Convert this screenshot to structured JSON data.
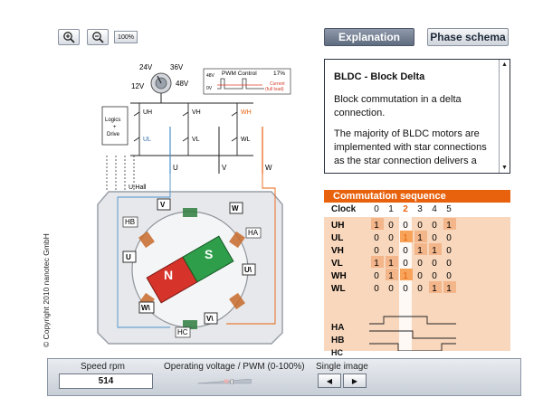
{
  "toolbar": {
    "zoom_in_icon": "zoom-in-icon",
    "zoom_out_icon": "zoom-out-icon",
    "zoom_reset_label": "100%",
    "explanation_label": "Explanation",
    "phase_schema_label": "Phase schema"
  },
  "explanation": {
    "title": "BLDC - Block Delta",
    "paragraph1": "Block commutation in a delta connection.",
    "paragraph2": "The majority of BLDC motors are implemented with star connections as the star connection delivers a"
  },
  "circuit": {
    "voltages": [
      "24V",
      "36V",
      "12V",
      "48V"
    ],
    "pwm_title": "PWM Control",
    "pwm_percent": "17%",
    "pwm_48v": "48V",
    "pwm_0v": "0V",
    "current_label": "Current",
    "current_sub": "(full load)",
    "logic_label_1": "Logics",
    "logic_label_2": "+",
    "logic_label_3": "Drive",
    "switches": [
      "UH",
      "VH",
      "WH",
      "UL",
      "VL",
      "WL"
    ],
    "phases": [
      "U",
      "V",
      "W"
    ],
    "uhall_label": "U-Hall",
    "hall_labels": [
      "HB",
      "HA",
      "HC"
    ],
    "coil_labels": [
      "V",
      "W",
      "U",
      "U\\",
      "W\\",
      "V\\"
    ],
    "rotor_n": "N",
    "rotor_s": "S"
  },
  "commutation": {
    "title": "Commutation sequence",
    "clock_label": "Clock",
    "clock_values": [
      "0",
      "1",
      "2",
      "3",
      "4",
      "5"
    ],
    "active_clock": 2,
    "rows": [
      {
        "label": "UH",
        "values": [
          "1",
          "0",
          "0",
          "0",
          "0",
          "1"
        ]
      },
      {
        "label": "UL",
        "values": [
          "0",
          "0",
          "1",
          "1",
          "0",
          "0"
        ]
      },
      {
        "label": "VH",
        "values": [
          "0",
          "0",
          "0",
          "1",
          "1",
          "0"
        ]
      },
      {
        "label": "VL",
        "values": [
          "1",
          "1",
          "0",
          "0",
          "0",
          "0"
        ]
      },
      {
        "label": "WH",
        "values": [
          "0",
          "1",
          "1",
          "0",
          "0",
          "0"
        ]
      },
      {
        "label": "WL",
        "values": [
          "0",
          "0",
          "0",
          "0",
          "1",
          "1"
        ]
      }
    ],
    "hall_rows": [
      "HA",
      "HB",
      "HC"
    ]
  },
  "controls": {
    "speed_label": "Speed rpm",
    "speed_value": "514",
    "voltage_label": "Operating voltage / PWM (0-100%)",
    "pwm_level": 0.65,
    "single_image_label": "Single image",
    "prev_icon": "prev-icon",
    "next_icon": "next-icon"
  },
  "copyright": "© Copyright 2010 nanotec GmbH",
  "colors": {
    "accent_orange": "#e8620e",
    "table_bg": "#f8d7bc",
    "rotor_north": "#d6332a",
    "rotor_south": "#2f9e4a",
    "phase_u": "#4a90c8",
    "phase_w": "#e8620e"
  }
}
